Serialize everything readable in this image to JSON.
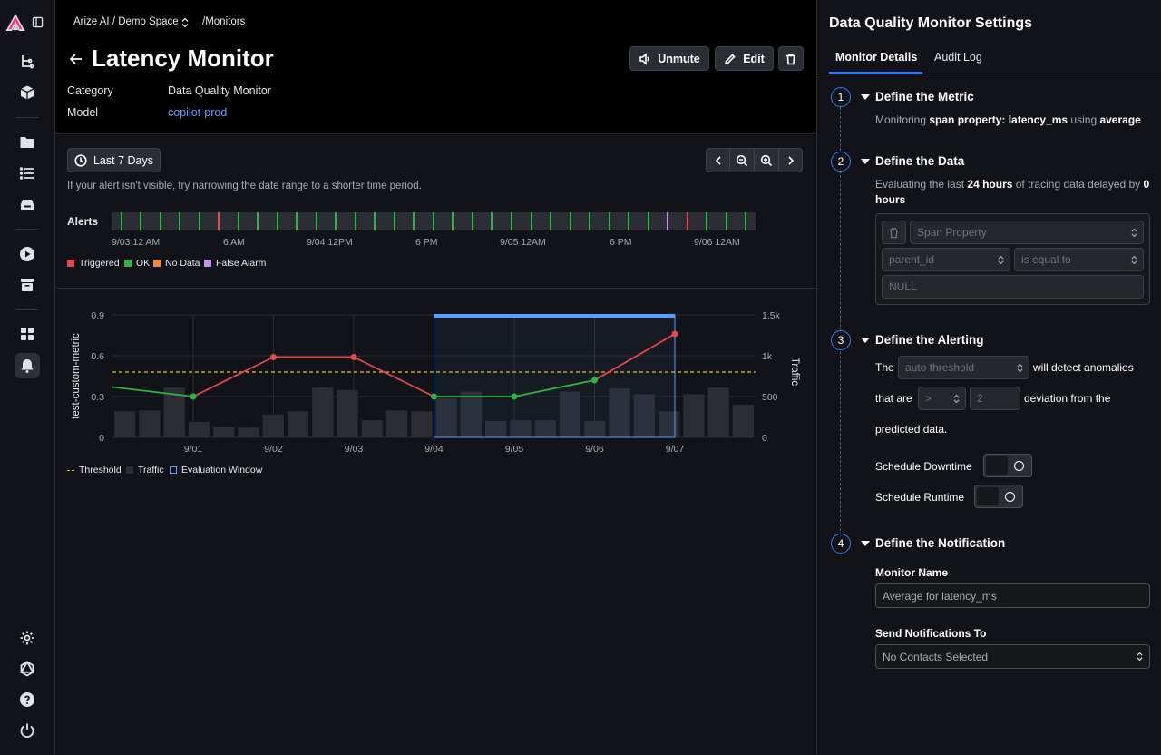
{
  "breadcrumb": {
    "space": "Arize AI / Demo Space",
    "page": "/Monitors"
  },
  "header": {
    "title": "Latency Monitor",
    "category_label": "Category",
    "category_value": "Data Quality Monitor",
    "model_label": "Model",
    "model_value": "copilot-prod",
    "unmute_label": "Unmute",
    "edit_label": "Edit"
  },
  "range": {
    "label": "Last 7 Days",
    "hint": "If your alert isn't visible, try narrowing the date range to a shorter time period."
  },
  "alerts": {
    "label": "Alerts",
    "ticks": [
      "ok",
      "ok",
      "ok",
      "ok",
      "ok",
      "triggered",
      "ok",
      "ok",
      "ok",
      "ok",
      "ok",
      "ok",
      "ok",
      "ok",
      "ok",
      "ok",
      "ok",
      "ok",
      "ok",
      "ok",
      "ok",
      "ok",
      "ok",
      "ok",
      "ok",
      "ok",
      "ok",
      "ok",
      "false_alarm",
      "triggered",
      "ok",
      "ok",
      "ok"
    ],
    "time_labels": [
      "9/03 12 AM",
      "6 AM",
      "9/04 12PM",
      "6 PM",
      "9/05 12AM",
      "6 PM",
      "9/06 12AM"
    ],
    "legend": [
      "Triggered",
      "OK",
      "No Data",
      "False Alarm"
    ],
    "colors": {
      "triggered": "#e5484d",
      "ok": "#2fb344",
      "no_data": "#f0883e",
      "false_alarm": "#c792ea"
    }
  },
  "chart_data": {
    "type": "line",
    "ylabel": "test-custom-metric",
    "y2label": "Traffic",
    "x": [
      "9/01",
      "9/02",
      "9/03",
      "9/04",
      "9/05",
      "9/06",
      "9/07"
    ],
    "yticks": [
      "0.9",
      "0.6",
      "0.3",
      "0"
    ],
    "y2ticks": [
      "1.5k",
      "1k",
      "500",
      "0"
    ],
    "ylim": [
      0,
      0.9
    ],
    "y2lim": [
      0,
      1500
    ],
    "threshold": 0.48,
    "series": [
      {
        "name": "metric",
        "points": [
          [
            0.33,
            0.37
          ],
          [
            1,
            0.3
          ],
          [
            2,
            0.59
          ],
          [
            3,
            0.59
          ],
          [
            4,
            0.3
          ],
          [
            5,
            0.3
          ],
          [
            6,
            0.42
          ],
          [
            7,
            0.76
          ]
        ]
      }
    ],
    "traffic": [
      320,
      330,
      610,
      190,
      130,
      120,
      280,
      320,
      610,
      580,
      210,
      330,
      320,
      480,
      560,
      200,
      210,
      210,
      560,
      200,
      600,
      530,
      320,
      530,
      610,
      400
    ],
    "evaluation_window": [
      4,
      7
    ],
    "legend": [
      "Threshold",
      "Traffic",
      "Evaluation Window"
    ]
  },
  "panel": {
    "title": "Data Quality Monitor Settings",
    "tabs": [
      "Monitor Details",
      "Audit Log"
    ],
    "step1": {
      "num": "1",
      "title": "Define the Metric",
      "text_a": "Monitoring ",
      "text_b": "span property: latency_ms",
      "text_c": " using ",
      "text_d": "average"
    },
    "step2": {
      "num": "2",
      "title": "Define the Data",
      "text_a": "Evaluating the last ",
      "text_b": "24 hours",
      "text_c": " of tracing data delayed by ",
      "text_d": "0 hours",
      "select1": "Span Property",
      "select2": "parent_id",
      "select3": "is equal to",
      "value": "NULL"
    },
    "step3": {
      "num": "3",
      "title": "Define the Alerting",
      "the": "The",
      "threshold_select": "auto threshold",
      "detect": "will detect anomalies",
      "that_are": "that are",
      "op_select": ">",
      "deviation": "2",
      "deviation_from": "deviation from the",
      "predicted": "predicted data.",
      "downtime": "Schedule Downtime",
      "runtime": "Schedule Runtime"
    },
    "step4": {
      "num": "4",
      "title": "Define the Notification",
      "name_label": "Monitor Name",
      "name_value": "Average for latency_ms",
      "send_label": "Send Notifications To",
      "send_value": "No Contacts Selected"
    }
  }
}
